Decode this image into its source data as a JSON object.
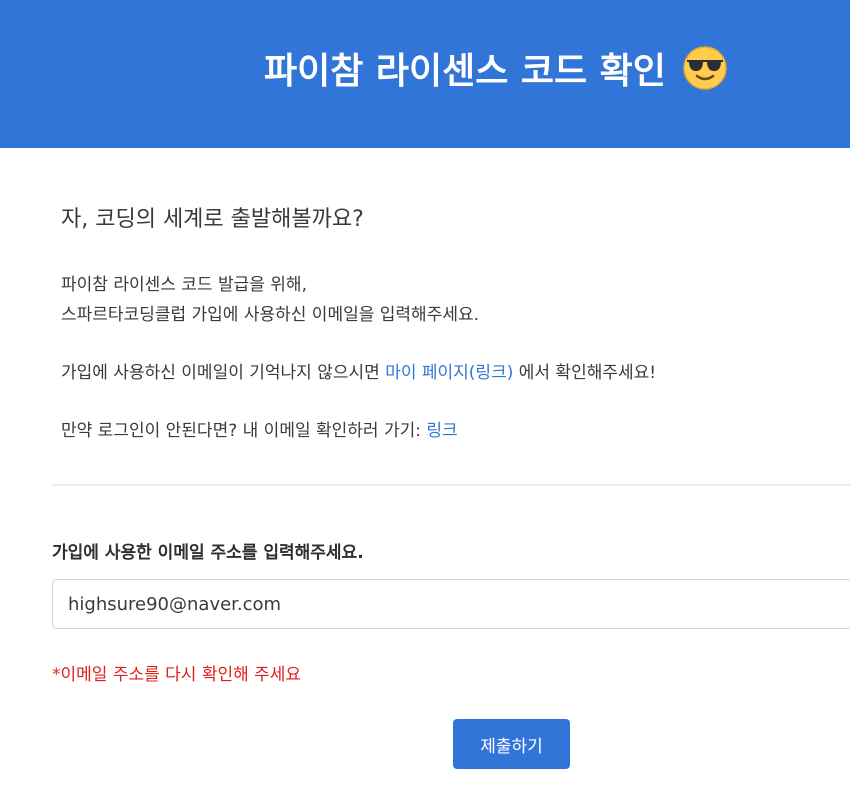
{
  "header": {
    "title": "파이참 라이센스 코드 확인",
    "emoji_icon": "sunglasses-face-icon",
    "background_color": "#3275d9"
  },
  "intro": {
    "heading": "자, 코딩의 세계로 출발해볼까요?",
    "line1": "파이참 라이센스 코드 발급을 위해,",
    "line2": "스파르타코딩클럽 가입에 사용하신 이메일을 입력해주세요.",
    "mypage_prefix": "가입에 사용하신 이메일이 기억나지 않으시면 ",
    "mypage_link": "마이 페이지(링크)",
    "mypage_suffix": " 에서 확인해주세요!",
    "login_prefix": "만약 로그인이 안된다면? 내 이메일 확인하러 가기: ",
    "login_link": "링크",
    "link_color": "#3275d9"
  },
  "form": {
    "label": "가입에 사용한 이메일 주소를 입력해주세요.",
    "email_value": "highsure90@naver.com",
    "error": "*이메일 주소를 다시 확인해 주세요",
    "error_color": "#e01e1e",
    "submit_label": "제출하기"
  }
}
